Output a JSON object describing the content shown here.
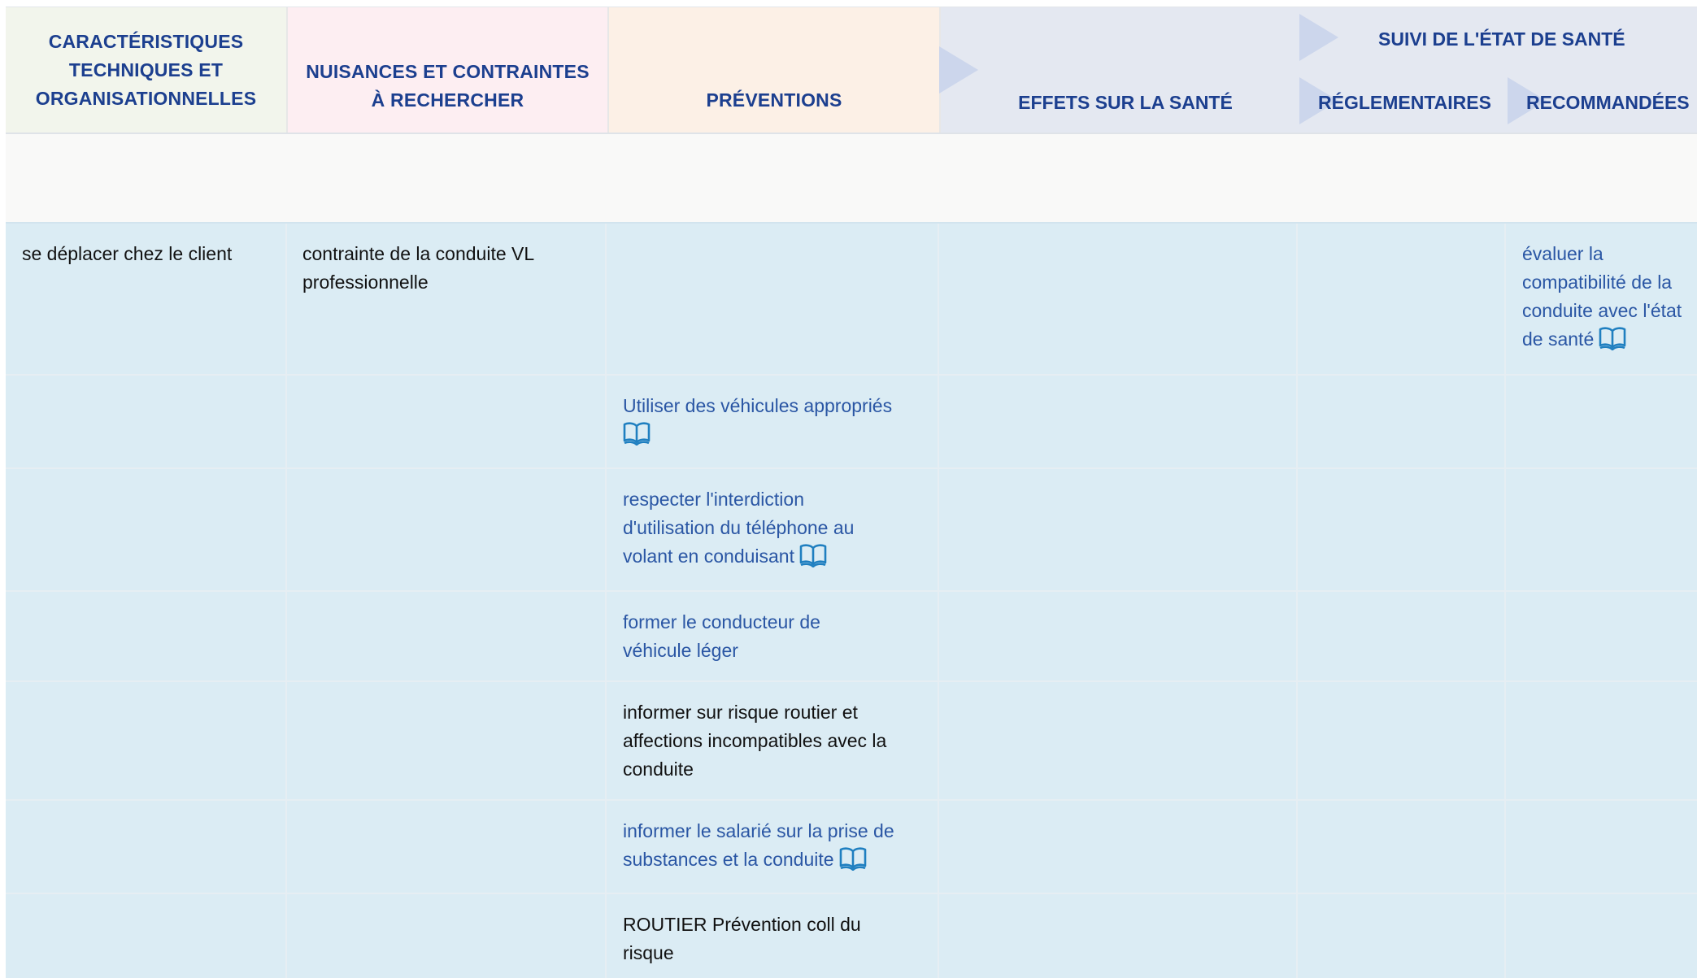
{
  "header": {
    "col1": "CARACTÉRISTIQUES TECHNIQUES ET ORGANISATIONNELLES",
    "col2": "NUISANCES ET CONTRAINTES À RECHERCHER",
    "col3": "PRÉVENTIONS",
    "col4": "EFFETS SUR LA SANTÉ",
    "suivi": "SUIVI DE L'ÉTAT DE SANTÉ",
    "reglementaires": "RÉGLEMENTAIRES",
    "recommandees": "RECOMMANDÉES"
  },
  "rows": [
    {
      "characteristic": "se déplacer chez le client",
      "nuisance": "contrainte de la conduite VL professionnelle",
      "recommended": "évaluer la compatibilité de la conduite avec l'état de santé",
      "recommended_has_book_icon": true
    }
  ],
  "preventions": [
    {
      "text": "Utiliser des véhicules appropriés",
      "link": true,
      "book_icon": true
    },
    {
      "text": "respecter l'interdiction d'utilisation du téléphone au volant en conduisant",
      "link": true,
      "book_icon": true
    },
    {
      "text": "former le conducteur de véhicule léger",
      "link": true,
      "book_icon": false
    },
    {
      "text": "informer sur risque routier et affections incompatibles avec la conduite",
      "link": false,
      "book_icon": false
    },
    {
      "text": "informer le salarié sur la prise de substances et la conduite",
      "link": true,
      "book_icon": true
    },
    {
      "text": "ROUTIER Prévention coll du risque",
      "link": false,
      "book_icon": false
    }
  ],
  "icons": {
    "book": "book-open-icon",
    "arrow": "chevron-right-arrow"
  },
  "colors": {
    "header_text": "#1c3f8f",
    "link_text": "#2a56a4",
    "icon": "#1f7fc0",
    "body_bg": "#dbecf4",
    "col1_header_bg": "#f2f5ec",
    "col2_header_bg": "#fdeef2",
    "col3_header_bg": "#fcf0e6",
    "col4_header_bg": "#e4e8f1"
  }
}
